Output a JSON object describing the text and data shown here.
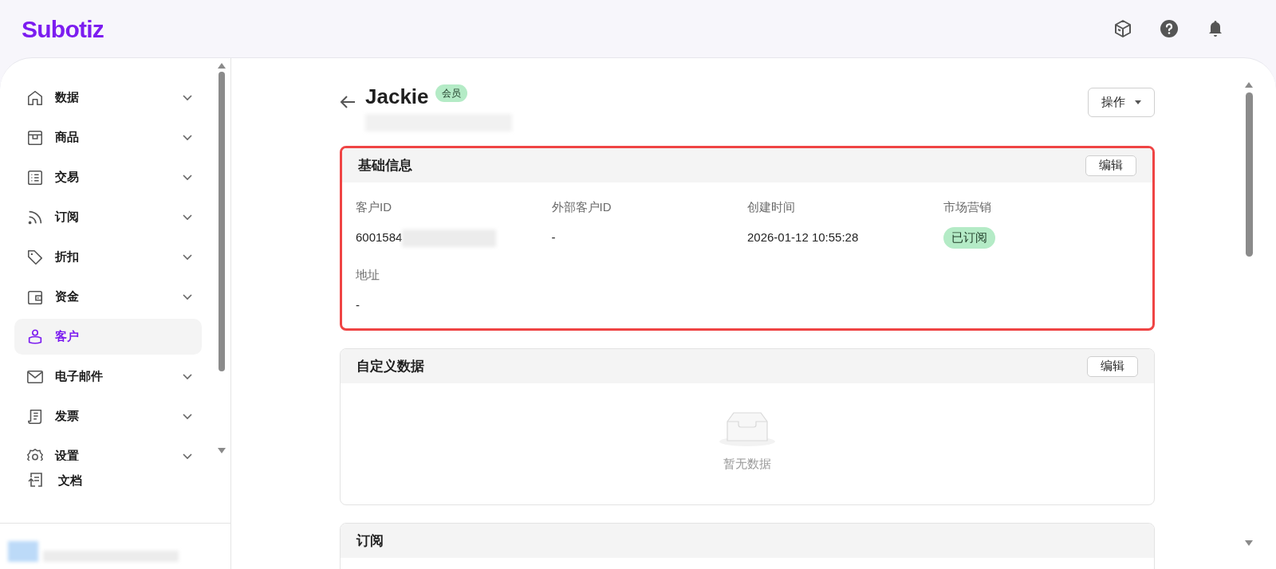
{
  "brand": "Subotiz",
  "sidebar": {
    "items": [
      {
        "label": "数据",
        "expandable": true,
        "selected": false
      },
      {
        "label": "商品",
        "expandable": true,
        "selected": false
      },
      {
        "label": "交易",
        "expandable": true,
        "selected": false
      },
      {
        "label": "订阅",
        "expandable": true,
        "selected": false
      },
      {
        "label": "折扣",
        "expandable": true,
        "selected": false
      },
      {
        "label": "资金",
        "expandable": true,
        "selected": false
      },
      {
        "label": "客户",
        "expandable": false,
        "selected": true
      },
      {
        "label": "电子邮件",
        "expandable": true,
        "selected": false
      },
      {
        "label": "发票",
        "expandable": true,
        "selected": false
      },
      {
        "label": "设置",
        "expandable": true,
        "selected": false
      }
    ],
    "footer_items": [
      {
        "label": "文档"
      }
    ]
  },
  "page": {
    "title": "Jackie",
    "badge": "会员",
    "actions_button": "操作"
  },
  "cards": [
    {
      "title": "基础信息",
      "edit_button": "编辑",
      "highlighted": true,
      "fields": [
        {
          "label": "客户ID",
          "value": "6001584",
          "redacted": true,
          "kind": "text"
        },
        {
          "label": "外部客户ID",
          "value": "-",
          "redacted": false,
          "kind": "text"
        },
        {
          "label": "创建时间",
          "value": "2026-01-12 10:55:28",
          "redacted": false,
          "kind": "text"
        },
        {
          "label": "市场营销",
          "value": "已订阅",
          "redacted": false,
          "kind": "tag"
        },
        {
          "label": "地址",
          "value": "-",
          "redacted": false,
          "kind": "text"
        }
      ]
    },
    {
      "title": "自定义数据",
      "edit_button": "编辑",
      "highlighted": false,
      "empty_text": "暂无数据"
    },
    {
      "title": "订阅",
      "highlighted": false
    }
  ]
}
